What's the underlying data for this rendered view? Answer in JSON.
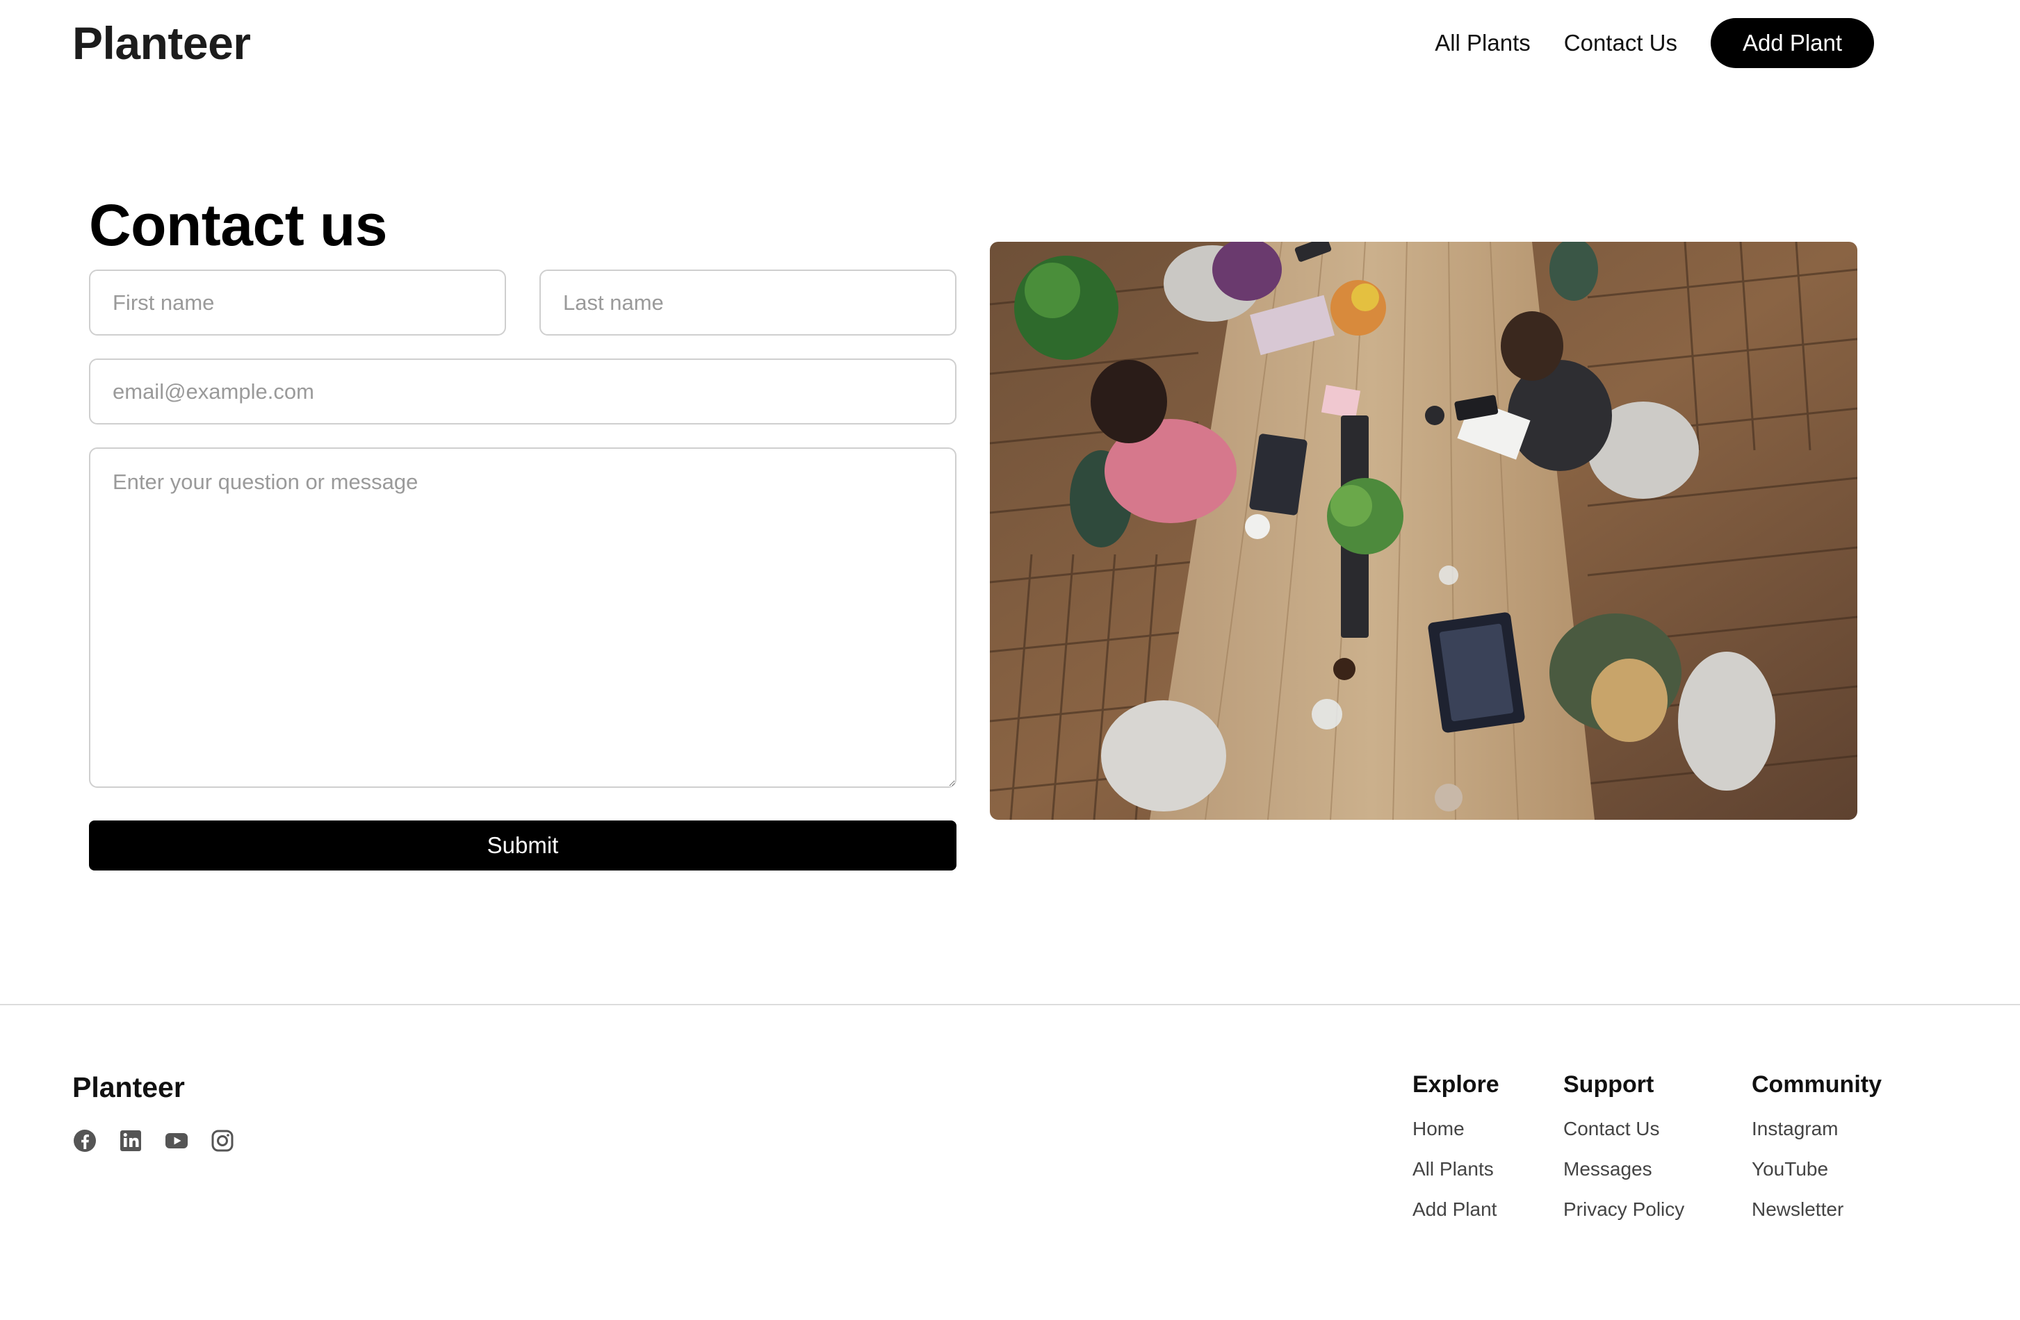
{
  "header": {
    "brand": "Planteer",
    "nav": [
      {
        "label": "All Plants"
      },
      {
        "label": "Contact Us"
      }
    ],
    "cta": "Add Plant"
  },
  "contact": {
    "title": "Contact us",
    "first_name_placeholder": "First name",
    "last_name_placeholder": "Last name",
    "email_placeholder": "email@example.com",
    "message_placeholder": "Enter your question or message",
    "submit_label": "Submit"
  },
  "photo": {
    "subject": "office-workspace-photo"
  },
  "footer": {
    "brand": "Planteer",
    "socials": [
      "facebook-icon",
      "linkedin-icon",
      "youtube-icon",
      "instagram-icon"
    ],
    "columns": [
      {
        "heading": "Explore",
        "links": [
          "Home",
          "All Plants",
          "Add Plant"
        ]
      },
      {
        "heading": "Support",
        "links": [
          "Contact Us",
          "Messages",
          "Privacy Policy"
        ]
      },
      {
        "heading": "Community",
        "links": [
          "Instagram",
          "YouTube",
          "Newsletter"
        ]
      }
    ]
  },
  "colors": {
    "primary": "#000000",
    "text": "#111111",
    "muted_text": "#444444",
    "placeholder": "#9a9a9a",
    "border": "#cfcfcf",
    "divider": "#dcdcdc",
    "icon": "#555555"
  }
}
